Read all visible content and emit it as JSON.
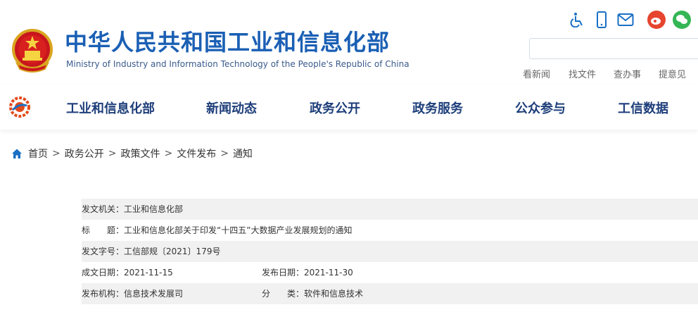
{
  "header": {
    "title_cn": "中华人民共和国工业和信息化部",
    "title_en": "Ministry of Industry and Information Technology of the People's Republic of China",
    "quick_links": [
      "看新闻",
      "找文件",
      "查办事",
      "提意见"
    ],
    "top_icons": [
      "accessibility-icon",
      "mobile-icon",
      "mail-icon",
      "weibo-icon",
      "wechat-icon"
    ],
    "colors": {
      "primary": "#1a5fb4",
      "nav_text": "#1e3e7a",
      "weibo": "#e6452f",
      "wechat": "#35b655"
    }
  },
  "nav": {
    "items": [
      "工业和信息化部",
      "新闻动态",
      "政务公开",
      "政务服务",
      "公众参与",
      "工信数据"
    ]
  },
  "breadcrumb": {
    "items": [
      "首页",
      "政务公开",
      "政策文件",
      "文件发布",
      "通知"
    ],
    "separator": ">"
  },
  "meta": {
    "issuer_label": "发文机关：",
    "issuer": "工业和信息化部",
    "title_label": "标　　题：",
    "title": "工业和信息化部关于印发“十四五”大数据产业发展规划的通知",
    "doc_no_label": "发文字号：",
    "doc_no": "工信部规〔2021〕179号",
    "created_label": "成文日期：",
    "created": "2021-11-15",
    "published_label": "发布日期：",
    "published": "2021-11-30",
    "org_label": "发布机构：",
    "org": "信息技术发展司",
    "category_label": "分　　类：",
    "category": "软件和信息技术"
  }
}
